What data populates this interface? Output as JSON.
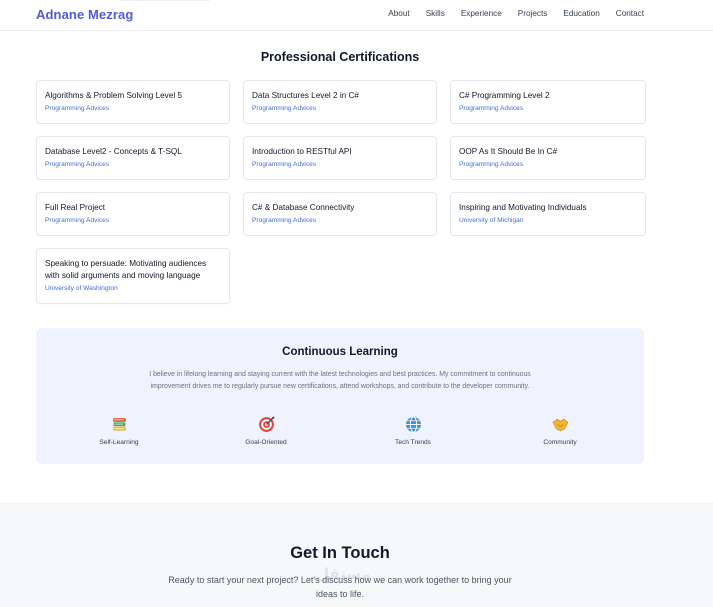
{
  "navbar": {
    "brand": "Adnane Mezrag",
    "links": [
      "About",
      "Skills",
      "Experience",
      "Projects",
      "Education",
      "Contact"
    ]
  },
  "certifications": {
    "title": "Professional Certifications",
    "items": [
      {
        "title": "Algorithms & Problem Solving Level 5",
        "issuer": "Programming Advices"
      },
      {
        "title": "Data Structures Level 2 in C#",
        "issuer": "Programming Advices"
      },
      {
        "title": "C# Programming Level 2",
        "issuer": "Programming Advices"
      },
      {
        "title": "Database Level2 - Concepts & T-SQL",
        "issuer": "Programming Advices"
      },
      {
        "title": "Introduction to RESTful API",
        "issuer": "Programming Advices"
      },
      {
        "title": "OOP As It Should Be In C#",
        "issuer": "Programming Advices"
      },
      {
        "title": "Full Real Project",
        "issuer": "Programming Advices"
      },
      {
        "title": "C# & Database Connectivity",
        "issuer": "Programming Advices"
      },
      {
        "title": "Inspiring and Motivating Individuals",
        "issuer": "University of Michigan"
      },
      {
        "title": "Speaking to persuade: Motivating audiences with solid arguments and moving language",
        "issuer": "University of Washington"
      }
    ]
  },
  "learning": {
    "title": "Continuous Learning",
    "text": "I believe in lifelong learning and staying current with the latest technologies and best practices. My commitment to continuous improvement drives me to regularly pursue new certifications, attend workshops, and contribute to the developer community.",
    "features": [
      {
        "label": "Self-Learning",
        "icon": "books-icon"
      },
      {
        "label": "Goal-Oriented",
        "icon": "target-icon"
      },
      {
        "label": "Tech Trends",
        "icon": "globe-icon"
      },
      {
        "label": "Community",
        "icon": "handshake-icon"
      }
    ]
  },
  "contact": {
    "title": "Get In Touch",
    "text": "Ready to start your next project? Let's discuss how we can work together to bring your ideas to life.",
    "watermark": "مستقل"
  },
  "colors": {
    "brand": "#4f5bd5",
    "issuer": "#3b6fd6",
    "learning_bg": "#eef3fd"
  }
}
